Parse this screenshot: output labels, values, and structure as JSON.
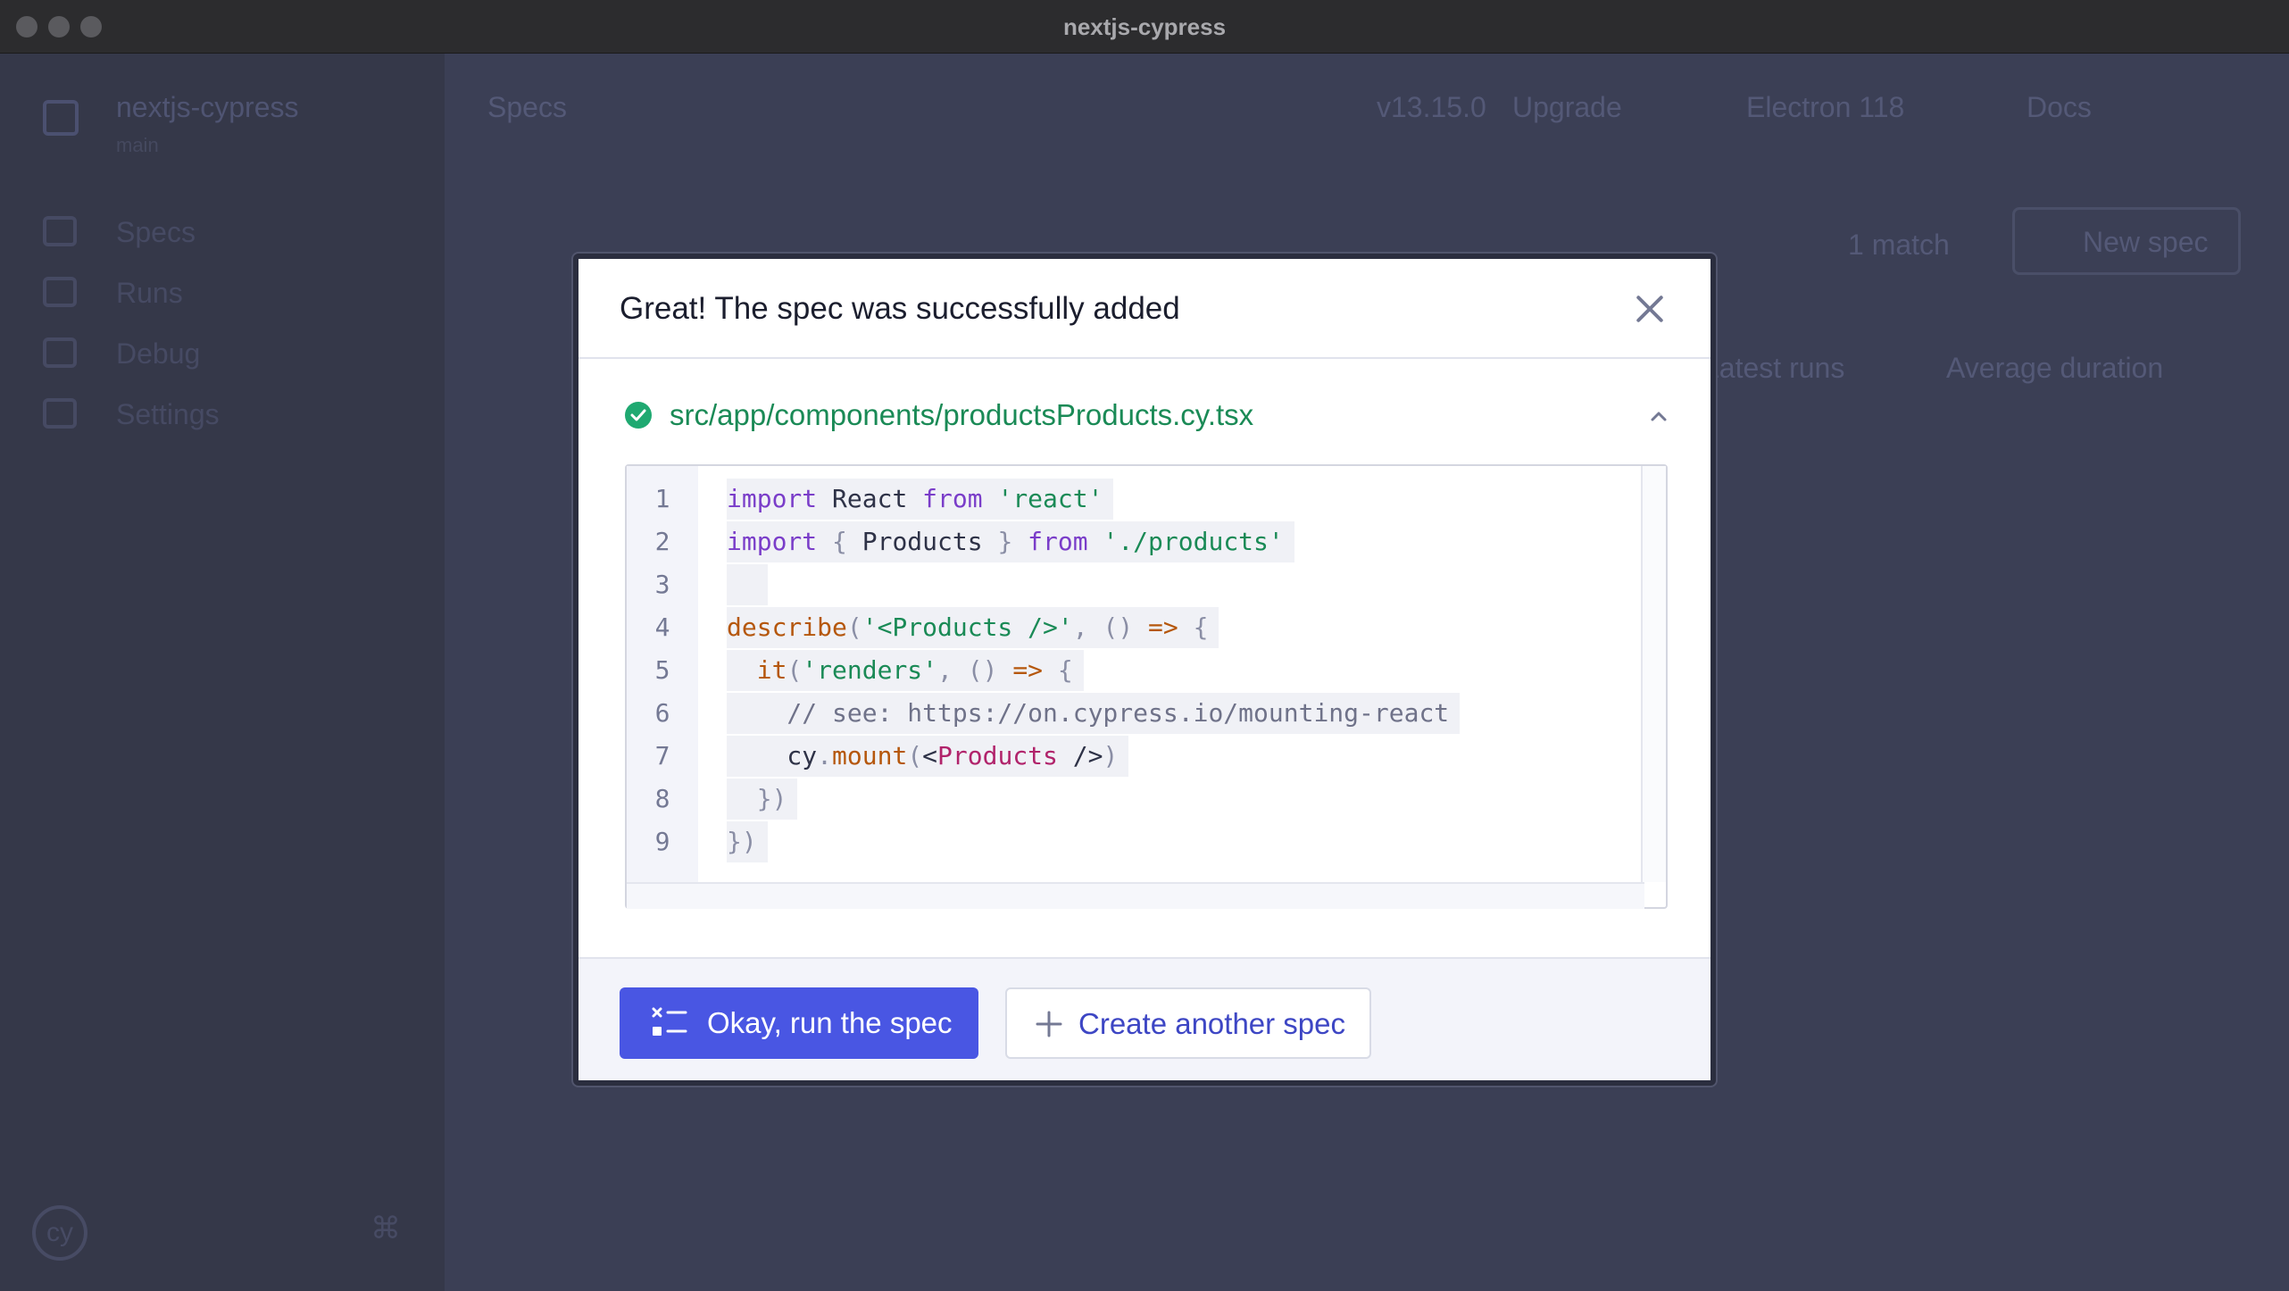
{
  "window": {
    "title": "nextjs-cypress"
  },
  "sidebar": {
    "project_name": "nextjs-cypress",
    "project_sub": "main",
    "items": [
      {
        "label": "Specs"
      },
      {
        "label": "Runs"
      },
      {
        "label": "Debug"
      },
      {
        "label": "Settings"
      }
    ],
    "logo_text": "cy"
  },
  "main": {
    "page_title": "Specs",
    "version": "v13.15.0",
    "upgrade_label": "Upgrade",
    "browser": "Electron 118",
    "docs_label": "Docs",
    "match_count": "1 match",
    "new_spec_label": "New spec",
    "col_latest_runs": "Latest runs",
    "col_avg_duration": "Average duration"
  },
  "modal": {
    "title": "Great! The spec was successfully added",
    "file_path": "src/app/components/productsProducts.cy.tsx",
    "line_numbers": [
      "1",
      "2",
      "3",
      "4",
      "5",
      "6",
      "7",
      "8",
      "9"
    ],
    "code_lines": [
      "import React from 'react'",
      "import { Products } from './products'",
      "",
      "describe('<Products />', () => {",
      "  it('renders', () => {",
      "    // see: https://on.cypress.io/mounting-react",
      "    cy.mount(<Products />)",
      "  })",
      "})"
    ],
    "primary_button": "Okay, run the spec",
    "secondary_button": "Create another spec"
  },
  "colors": {
    "primary": "#4956e3",
    "success": "#1fa971",
    "file_path": "#1a8a56"
  }
}
